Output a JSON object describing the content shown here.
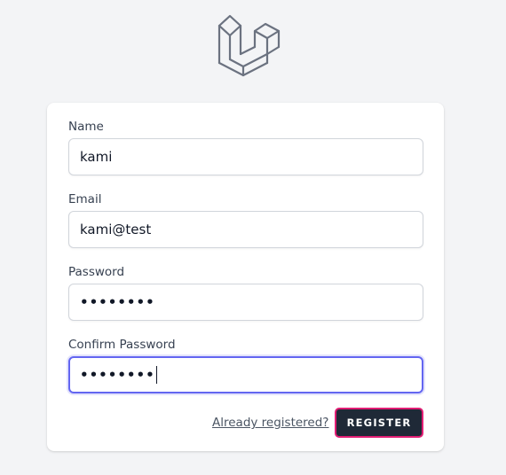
{
  "logo": {
    "icon": "laravel-logo-icon"
  },
  "form": {
    "name_label": "Name",
    "name_value": "kami",
    "email_label": "Email",
    "email_value": "kami@test",
    "password_label": "Password",
    "password_mask": "••••••••",
    "confirm_label": "Confirm Password",
    "confirm_mask": "••••••••",
    "already_registered": "Already registered?",
    "register_label": "REGISTER"
  },
  "colors": {
    "focus_ring": "#6366f1",
    "button_bg": "#1f2937",
    "button_border": "#e11d74",
    "page_bg": "#f3f4f6",
    "logo_stroke": "#6b7280"
  }
}
